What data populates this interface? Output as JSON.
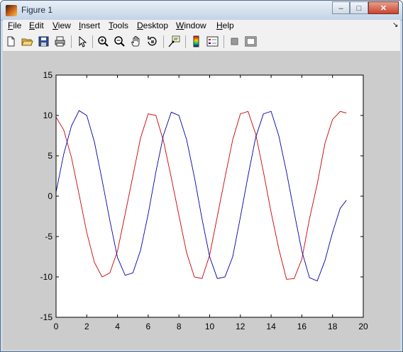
{
  "window": {
    "title": "Figure 1",
    "controls": {
      "minimize": "–",
      "maximize": "□",
      "close": "✕"
    }
  },
  "menu": {
    "items": [
      {
        "label": "File",
        "mnemonic": "F",
        "rest": "ile"
      },
      {
        "label": "Edit",
        "mnemonic": "E",
        "rest": "dit"
      },
      {
        "label": "View",
        "mnemonic": "V",
        "rest": "iew"
      },
      {
        "label": "Insert",
        "mnemonic": "I",
        "rest": "nsert"
      },
      {
        "label": "Tools",
        "mnemonic": "T",
        "rest": "ools"
      },
      {
        "label": "Desktop",
        "mnemonic": "D",
        "rest": "esktop"
      },
      {
        "label": "Window",
        "mnemonic": "W",
        "rest": "indow"
      },
      {
        "label": "Help",
        "mnemonic": "H",
        "rest": "elp"
      }
    ],
    "dock_arrow": "↘"
  },
  "toolbar": {
    "buttons": [
      "new-figure-icon",
      "open-file-icon",
      "save-icon",
      "print-icon",
      "edit-plot-arrow-icon",
      "zoom-in-icon",
      "zoom-out-icon",
      "pan-hand-icon",
      "rotate-3d-icon",
      "data-cursor-icon",
      "insert-colorbar-icon",
      "insert-legend-icon",
      "hide-plot-tools-icon",
      "show-plot-tools-icon"
    ]
  },
  "colors": {
    "series_red": "#cc0000",
    "series_blue": "#0000aa",
    "figure_bg": "#cccccc"
  },
  "chart_data": {
    "type": "line",
    "xlim": [
      0,
      20
    ],
    "ylim": [
      -15,
      15
    ],
    "xticks": [
      0,
      2,
      4,
      6,
      8,
      10,
      12,
      14,
      16,
      18,
      20
    ],
    "yticks": [
      15,
      10,
      5,
      0,
      -5,
      -10,
      -15
    ],
    "grid": false,
    "series": [
      {
        "color": "#cc0000",
        "x": [
          0,
          0.5,
          1,
          1.5,
          2,
          2.5,
          3,
          3.5,
          4,
          4.5,
          5,
          5.5,
          6,
          6.5,
          7,
          7.5,
          8,
          8.5,
          9,
          9.5,
          10,
          10.5,
          11,
          11.5,
          12,
          12.5,
          13,
          13.5,
          14,
          14.5,
          15,
          15.5,
          16,
          16.5,
          17,
          17.5,
          18,
          18.5,
          18.9
        ],
        "y": [
          9.8,
          8.2,
          4.8,
          0.2,
          -4.5,
          -8.2,
          -10.0,
          -9.5,
          -6.8,
          -2.2,
          2.5,
          7.2,
          10.2,
          10.0,
          6.8,
          2.3,
          -2.4,
          -7.0,
          -10.0,
          -10.2,
          -7.3,
          -2.5,
          2.3,
          7.0,
          10.2,
          10.5,
          7.7,
          3.0,
          -2.0,
          -6.5,
          -10.3,
          -10.2,
          -7.8,
          -2.8,
          1.5,
          6.5,
          9.5,
          10.5,
          10.3
        ]
      },
      {
        "color": "#0000aa",
        "x": [
          0,
          0.5,
          1,
          1.5,
          2,
          2.5,
          3,
          3.5,
          4,
          4.5,
          5,
          5.5,
          6,
          6.5,
          7,
          7.5,
          8,
          8.5,
          9,
          9.5,
          10,
          10.5,
          11,
          11.5,
          12,
          12.5,
          13,
          13.5,
          14,
          14.5,
          15,
          15.5,
          16,
          16.5,
          17,
          17.5,
          18,
          18.5,
          18.9
        ],
        "y": [
          0.5,
          5.2,
          8.7,
          10.6,
          10.0,
          6.7,
          2.0,
          -3.0,
          -7.6,
          -9.8,
          -9.5,
          -6.7,
          -2.2,
          3.0,
          7.6,
          10.4,
          10.0,
          7.0,
          2.4,
          -2.8,
          -7.5,
          -10.2,
          -10.0,
          -7.5,
          -2.6,
          2.5,
          7.3,
          10.2,
          10.5,
          7.5,
          3.0,
          -2.0,
          -6.8,
          -10.1,
          -10.5,
          -8.0,
          -4.5,
          -1.5,
          -0.5
        ]
      }
    ]
  }
}
